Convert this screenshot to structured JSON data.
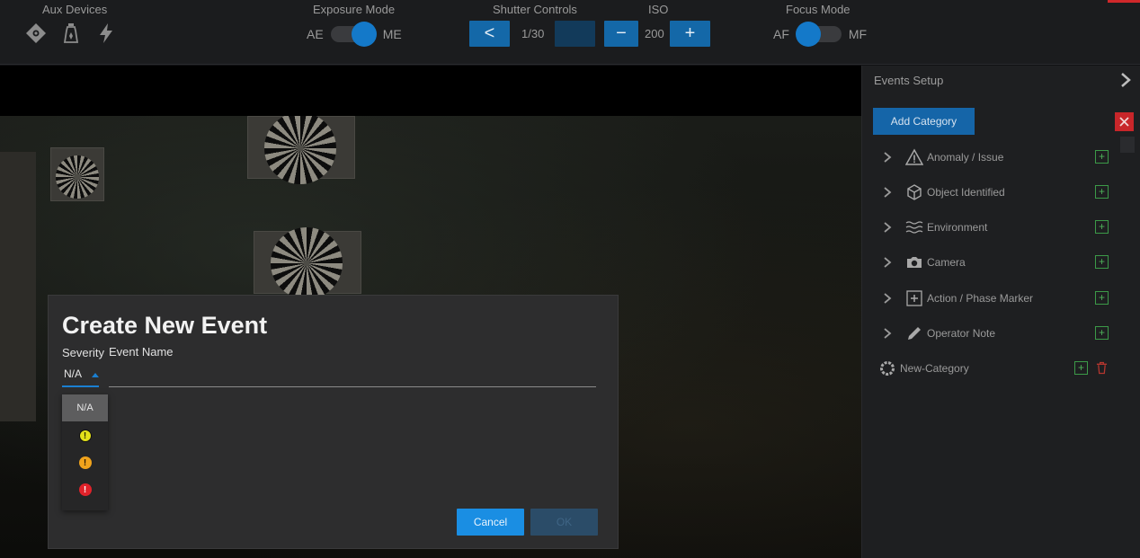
{
  "toolbar": {
    "aux_label": "Aux Devices",
    "exposure_label": "Exposure Mode",
    "exposure_left": "AE",
    "exposure_right": "ME",
    "shutter_label": "Shutter Controls",
    "shutter_prev": "<",
    "shutter_value": "1/30",
    "iso_label": "ISO",
    "iso_minus": "−",
    "iso_value": "200",
    "iso_plus": "+",
    "focus_label": "Focus Mode",
    "focus_left": "AF",
    "focus_right": "MF",
    "accent_color": "#d0282b",
    "toggle_color": "#1479c9"
  },
  "panel": {
    "title": "Events Setup",
    "add_category": "Add Category",
    "categories": [
      {
        "label": "Anomaly / Issue",
        "icon": "warning-triangle-icon"
      },
      {
        "label": "Object Identified",
        "icon": "cube-icon"
      },
      {
        "label": "Environment",
        "icon": "waves-icon"
      },
      {
        "label": "Camera",
        "icon": "camera-icon"
      },
      {
        "label": "Action / Phase Marker",
        "icon": "plus-box-icon"
      },
      {
        "label": "Operator Note",
        "icon": "pencil-icon"
      }
    ],
    "new_category": "New-Category"
  },
  "dialog": {
    "title": "Create New Event",
    "severity_label": "Severity",
    "event_name_label": "Event Name",
    "severity_value": "N/A",
    "event_name_value": "",
    "severity_options": [
      {
        "label": "N/A",
        "color": ""
      },
      {
        "label": "!",
        "color": "#e3e01a"
      },
      {
        "label": "!",
        "color": "#f0a31c"
      },
      {
        "label": "!",
        "color": "#e0222a"
      }
    ],
    "cancel": "Cancel",
    "ok": "OK"
  }
}
